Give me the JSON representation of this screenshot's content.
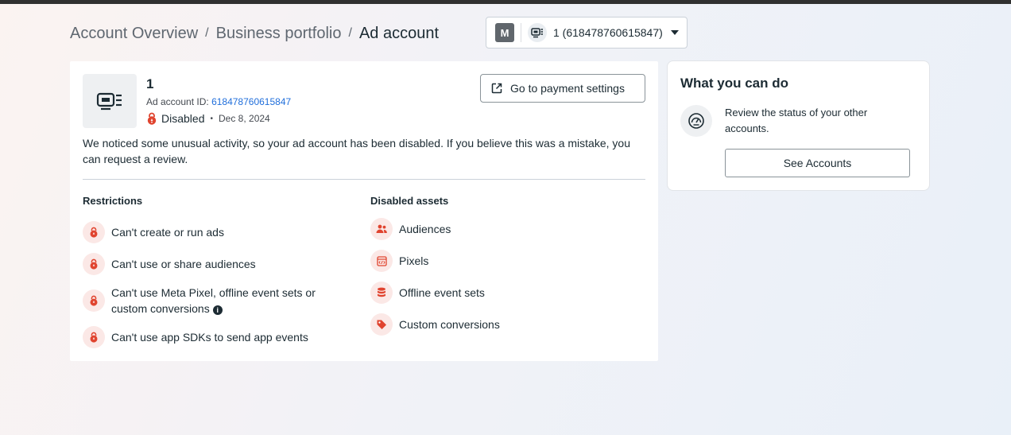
{
  "breadcrumb": {
    "items": [
      "Account Overview",
      "Business portfolio"
    ],
    "separator": "/",
    "current": "Ad account"
  },
  "account_selector": {
    "badge": "M",
    "label": "1 (618478760615847)"
  },
  "account": {
    "name": "1",
    "id_label": "Ad account ID:",
    "id_value": "618478760615847",
    "status": "Disabled",
    "status_separator": "•",
    "date": "Dec 8, 2024",
    "payment_button": "Go to payment settings",
    "notice": "We noticed some unusual activity, so your ad account has been disabled. If you believe this was a mistake, you can request a review."
  },
  "restrictions": {
    "title": "Restrictions",
    "items": [
      {
        "label": "Can't create or run ads",
        "icon": "lock-icon"
      },
      {
        "label": "Can't use or share audiences",
        "icon": "lock-icon"
      },
      {
        "label": "Can't use Meta Pixel, offline event sets or custom conversions",
        "icon": "lock-icon",
        "info": true
      },
      {
        "label": "Can't use app SDKs to send app events",
        "icon": "lock-icon"
      }
    ]
  },
  "disabled_assets": {
    "title": "Disabled assets",
    "items": [
      {
        "label": "Audiences",
        "icon": "people-icon"
      },
      {
        "label": "Pixels",
        "icon": "code-icon"
      },
      {
        "label": "Offline event sets",
        "icon": "database-icon"
      },
      {
        "label": "Custom conversions",
        "icon": "tag-icon"
      }
    ]
  },
  "side_panel": {
    "title": "What you can do",
    "text": "Review the status of your other accounts.",
    "button": "See Accounts",
    "icon": "gauge-icon"
  },
  "colors": {
    "accent_red": "#e0442f",
    "link_blue": "#216fdb",
    "icon_bubble": "#fbe8e6"
  }
}
